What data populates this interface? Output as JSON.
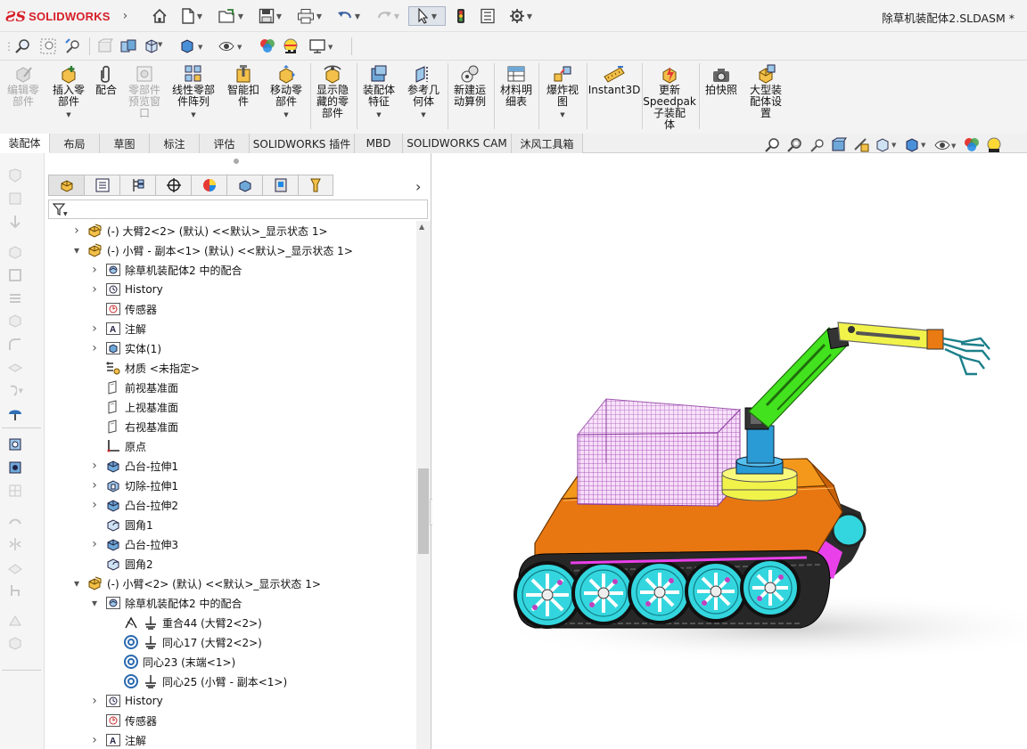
{
  "app": {
    "brand": "SOLIDWORKS",
    "document_title": "除草机装配体2.SLDASM *"
  },
  "quick_access": {
    "icons": [
      "home-icon",
      "new-document-icon",
      "open-icon",
      "save-icon",
      "print-icon",
      "undo-icon",
      "redo-icon",
      "select-arrow-icon",
      "rebuild-light-icon",
      "file-properties-icon",
      "options-gear-icon"
    ]
  },
  "ribbon": {
    "buttons": [
      {
        "id": "edit-component",
        "label": "编辑零\n部件",
        "disabled": true
      },
      {
        "id": "insert-components",
        "label": "插入零\n部件",
        "disabled": false,
        "dropdown": true
      },
      {
        "id": "mate",
        "label": "配合",
        "disabled": false
      },
      {
        "id": "component-preview",
        "label": "零部件\n预览窗\n口",
        "disabled": true
      },
      {
        "id": "linear-pattern",
        "label": "线性零部\n件阵列",
        "disabled": false,
        "dropdown": true
      },
      {
        "id": "smart-fasteners",
        "label": "智能扣\n件",
        "disabled": false
      },
      {
        "id": "move-component",
        "label": "移动零\n部件",
        "disabled": false,
        "dropdown": true
      },
      {
        "id": "show-hidden",
        "label": "显示隐\n藏的零\n部件",
        "disabled": false
      },
      {
        "id": "assembly-features",
        "label": "装配体\n特征",
        "disabled": false,
        "dropdown": true
      },
      {
        "id": "reference-geometry",
        "label": "参考几\n何体",
        "disabled": false,
        "dropdown": true
      },
      {
        "id": "new-motion-study",
        "label": "新建运\n动算例",
        "disabled": false
      },
      {
        "id": "bom",
        "label": "材料明\n细表",
        "disabled": false
      },
      {
        "id": "exploded-view",
        "label": "爆炸视\n图",
        "disabled": false,
        "dropdown": true
      },
      {
        "id": "instant3d",
        "label": "Instant3D",
        "disabled": false
      },
      {
        "id": "speedpak",
        "label": "更新\nSpeedpak\n子装配\n体",
        "disabled": false
      },
      {
        "id": "snapshot",
        "label": "拍快照",
        "disabled": false
      },
      {
        "id": "large-assembly",
        "label": "大型装\n配体设\n置",
        "disabled": false
      }
    ]
  },
  "tabs": [
    "装配体",
    "布局",
    "草图",
    "标注",
    "评估",
    "SOLIDWORKS 插件",
    "MBD",
    "SOLIDWORKS CAM",
    "沐风工具箱"
  ],
  "active_tab": "装配体",
  "feature_tree": {
    "panel_tabs": [
      "featuremanager-icon",
      "propertymanager-icon",
      "configurationmanager-icon",
      "dimxpert-icon",
      "display-manager-icon",
      "cam-feature-icon",
      "cam-operation-icon",
      "cam-tools-icon"
    ],
    "rows": [
      {
        "indent": 0,
        "twisty": "right",
        "icon": "assembly-part-icon",
        "label": "(-) 大臂2<2> (默认) <<默认>_显示状态 1>"
      },
      {
        "indent": 0,
        "twisty": "down",
        "icon": "assembly-part-icon",
        "label": "(-) 小臂 - 副本<1> (默认) <<默认>_显示状态 1>"
      },
      {
        "indent": 1,
        "twisty": "right",
        "icon": "mates-folder-icon",
        "label": "除草机装配体2 中的配合"
      },
      {
        "indent": 1,
        "twisty": "right",
        "icon": "history-folder-icon",
        "label": "History"
      },
      {
        "indent": 1,
        "twisty": "",
        "icon": "sensors-folder-icon",
        "label": "传感器"
      },
      {
        "indent": 1,
        "twisty": "right",
        "icon": "annotations-icon",
        "label": "注解"
      },
      {
        "indent": 1,
        "twisty": "right",
        "icon": "solid-bodies-icon",
        "label": "实体(1)"
      },
      {
        "indent": 1,
        "twisty": "",
        "icon": "material-icon",
        "label": "材质 <未指定>"
      },
      {
        "indent": 1,
        "twisty": "",
        "icon": "plane-icon",
        "label": "前视基准面"
      },
      {
        "indent": 1,
        "twisty": "",
        "icon": "plane-icon",
        "label": "上视基准面"
      },
      {
        "indent": 1,
        "twisty": "",
        "icon": "plane-icon",
        "label": "右视基准面"
      },
      {
        "indent": 1,
        "twisty": "",
        "icon": "origin-icon",
        "label": "原点"
      },
      {
        "indent": 1,
        "twisty": "right",
        "icon": "boss-extrude-icon",
        "label": "凸台-拉伸1"
      },
      {
        "indent": 1,
        "twisty": "right",
        "icon": "cut-extrude-icon",
        "label": "切除-拉伸1"
      },
      {
        "indent": 1,
        "twisty": "right",
        "icon": "boss-extrude-icon",
        "label": "凸台-拉伸2"
      },
      {
        "indent": 1,
        "twisty": "",
        "icon": "fillet-icon",
        "label": "圆角1"
      },
      {
        "indent": 1,
        "twisty": "right",
        "icon": "boss-extrude-icon",
        "label": "凸台-拉伸3"
      },
      {
        "indent": 1,
        "twisty": "",
        "icon": "fillet-icon",
        "label": "圆角2"
      },
      {
        "indent": 0,
        "twisty": "down",
        "icon": "assembly-part-icon",
        "label": "(-) 小臂<2> (默认) <<默认>_显示状态 1>"
      },
      {
        "indent": 1,
        "twisty": "down",
        "icon": "mates-folder-icon",
        "label": "除草机装配体2 中的配合"
      },
      {
        "indent": 2,
        "twisty": "",
        "icon": "coincident-mate-icon",
        "label": "重合44 (大臂2<2>)"
      },
      {
        "indent": 2,
        "twisty": "",
        "icon": "concentric-mate-icon",
        "label": "同心17 (大臂2<2>)"
      },
      {
        "indent": 2,
        "twisty": "",
        "icon": "concentric-icon",
        "label": "同心23 (末端<1>)"
      },
      {
        "indent": 2,
        "twisty": "",
        "icon": "concentric-mate-icon",
        "label": "同心25 (小臂 - 副本<1>)"
      },
      {
        "indent": 1,
        "twisty": "right",
        "icon": "history-folder-icon",
        "label": "History"
      },
      {
        "indent": 1,
        "twisty": "",
        "icon": "sensors-folder-icon",
        "label": "传感器"
      },
      {
        "indent": 1,
        "twisty": "right",
        "icon": "annotations-icon",
        "label": "注解"
      }
    ]
  },
  "colors": {
    "brand_red": "#d71e28",
    "chassis_orange": "#e87712",
    "wheel_cyan": "#33d6de",
    "basket_pink": "#e4a3ea",
    "arm_green": "#43e21e",
    "arm_yellow": "#f1f34a"
  }
}
